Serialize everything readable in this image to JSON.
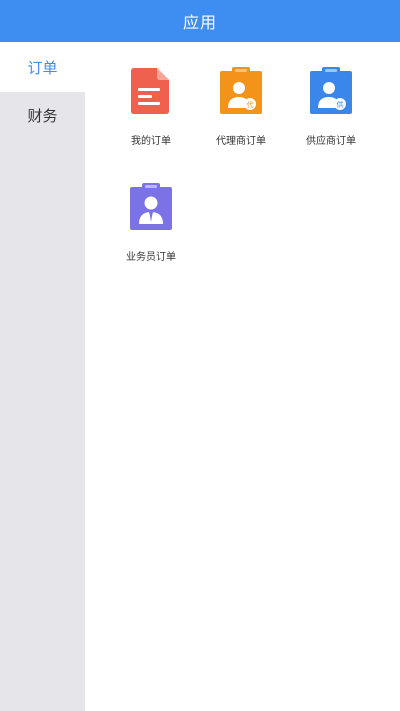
{
  "header": {
    "title": "应用"
  },
  "sidebar": {
    "items": [
      {
        "label": "订单",
        "active": true
      },
      {
        "label": "财务",
        "active": false
      }
    ]
  },
  "apps": [
    {
      "label": "我的订单",
      "icon": "document-icon",
      "color": "#f0604e"
    },
    {
      "label": "代理商订单",
      "icon": "agent-clipboard-icon",
      "color": "#f39319"
    },
    {
      "label": "供应商订单",
      "icon": "supplier-clipboard-icon",
      "color": "#3a86ea"
    },
    {
      "label": "业务员订单",
      "icon": "salesman-clipboard-icon",
      "color": "#7b72e6"
    }
  ],
  "colors": {
    "accent": "#3d8ef0",
    "sidebar_bg": "#e6e6ea"
  }
}
